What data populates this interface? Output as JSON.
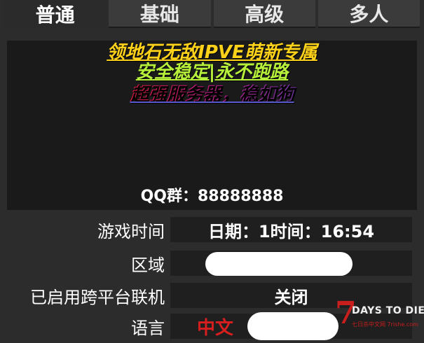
{
  "tabs": [
    {
      "label": "普通",
      "active": true
    },
    {
      "label": "基础",
      "active": false
    },
    {
      "label": "高级",
      "active": false
    },
    {
      "label": "多人",
      "active": false
    }
  ],
  "banner": {
    "line1": "领地石无敌IPVE萌新专属",
    "line2": "安全稳定|永不跑路",
    "line3": "超强服务器，稳如狗",
    "qq": "QQ群：88888888"
  },
  "info": {
    "game_time_label": "游戏时间",
    "game_time_value": "日期：1时间：16:54",
    "region_label": "区域",
    "region_value": "",
    "crossplay_label": "已启用跨平台联机",
    "crossplay_value": "关闭",
    "language_label": "语言",
    "language_value": "中文"
  },
  "logo": {
    "number": "7",
    "title": "DAYS TO DIE",
    "subtitle": "七日杀中文网 7rishe.com"
  },
  "colors": {
    "background": "#2c2c2c",
    "panel": "#1f1f1f",
    "line1": "#ffd21a",
    "line2": "#b6f03a",
    "language": "#d81e1e"
  }
}
